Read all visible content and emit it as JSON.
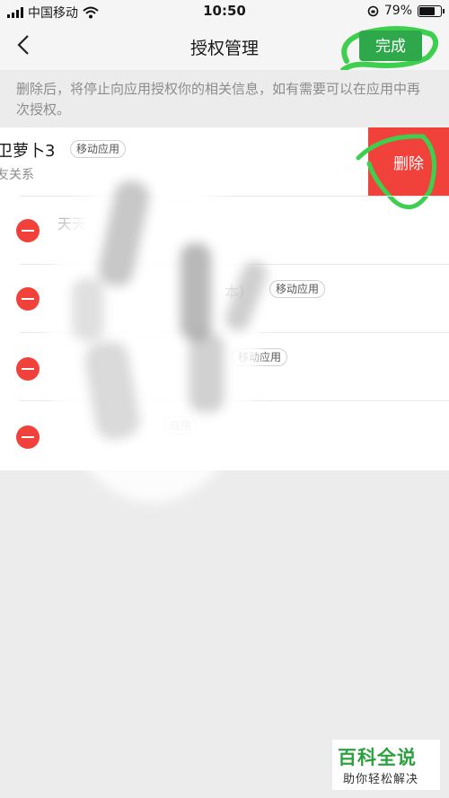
{
  "status_bar": {
    "carrier": "中国移动",
    "time": "10:50",
    "battery": "79%",
    "battery_level": 0.79
  },
  "nav": {
    "title": "授权管理",
    "done_label": "完成"
  },
  "hint": "删除后，将停止向应用授权你的相关信息，如有需要可以在应用中再次授权。",
  "list": {
    "first_item": {
      "name": "卫萝卜3",
      "tag": "移动应用",
      "subtitle": "友关系",
      "delete_label": "删除"
    },
    "items": [
      {
        "name_fragment": "天天",
        "tag": ""
      },
      {
        "name_fragment": "本）",
        "tag": "移动应用"
      },
      {
        "name_fragment": "",
        "tag": "移动应用"
      },
      {
        "name_fragment": "",
        "tag": "应用"
      }
    ]
  },
  "watermark": {
    "title": "百科全说",
    "subtitle": "助你轻松解决"
  },
  "colors": {
    "accent_green": "#2ea84b",
    "delete_red": "#f0413a"
  }
}
